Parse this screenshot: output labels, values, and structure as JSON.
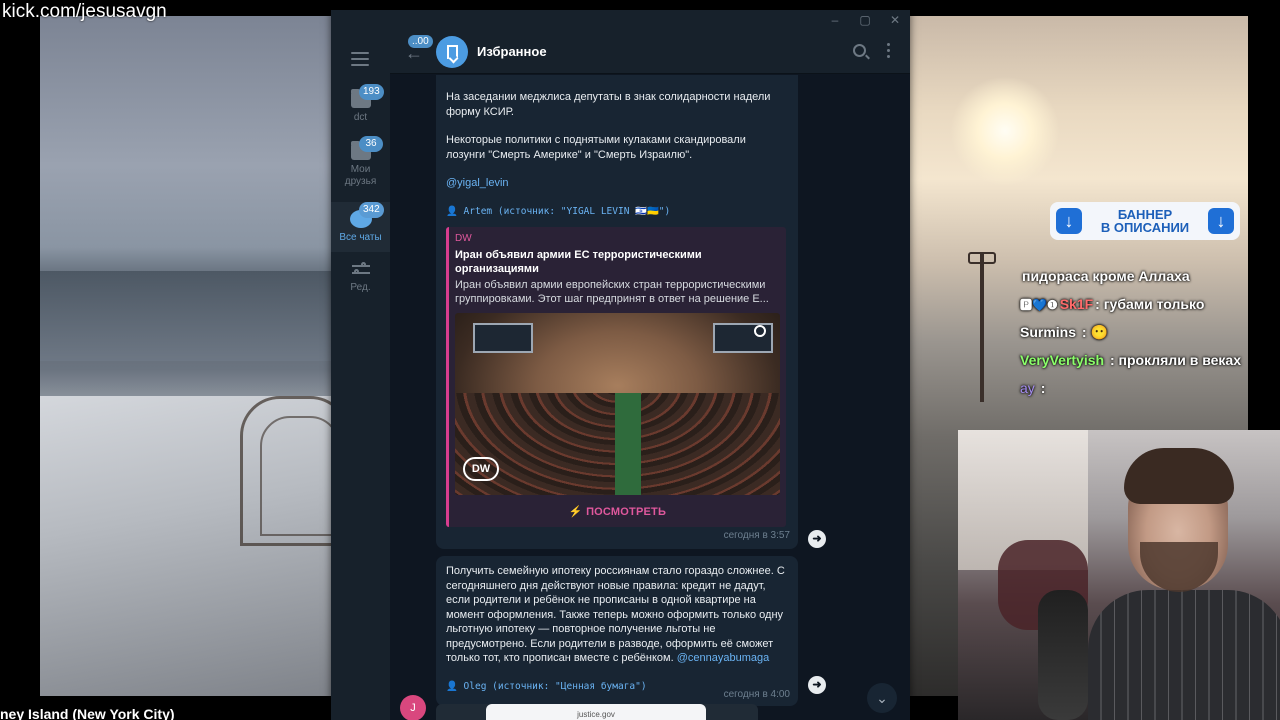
{
  "stream": {
    "url_overlay": "kick.com/jesusavgn",
    "location_caption": "ney Island (New York City)"
  },
  "banner": {
    "line1": "БАННЕР",
    "line2": "В ОПИСАНИИ"
  },
  "chat": [
    {
      "nick": "",
      "nick_color": "#ffffff",
      "text": "пидораса кроме Аллаха"
    },
    {
      "nick": "Sk1F",
      "nick_color": "#ff6b6b",
      "badges": "🅿💙❶",
      "text": ": губами только"
    },
    {
      "nick": "Surmins",
      "nick_color": "#ffffff",
      "text": ": 😶"
    },
    {
      "nick": "VeryVertyish",
      "nick_color": "#8bff6a",
      "text": ": прокляли в веках"
    },
    {
      "nick": "ay",
      "nick_color": "#a48cf0",
      "text": ":"
    }
  ],
  "telegram": {
    "window_controls": [
      "–",
      "▢",
      "✕"
    ],
    "unread_back": "..00",
    "chat_title": "Избранное",
    "folders": [
      {
        "label": "dct",
        "badge": "193"
      },
      {
        "label": "Мои друзья",
        "badge": "36"
      },
      {
        "label": "Все чаты",
        "badge": "342"
      },
      {
        "label": "Ред.",
        "badge": ""
      }
    ],
    "message1": {
      "para1": "На заседании меджлиса депутаты в знак солидарности надели форму КСИР.",
      "para2": "Некоторые политики с поднятыми кулаками скандировали лозунги \"Смерть Америке\" и \"Смерть Израилю\".",
      "link": "@yigal_levin",
      "forward": "👤 Artem (источник: \"YIGAL LEVIN 🇮🇱🇺🇦\")",
      "preview": {
        "site": "DW",
        "title": "Иран объявил армии ЕС террористическими организациями",
        "description": "Иран объявил армии европейских стран террористическими группировками. Этот шаг предпринят в ответ на решение Е...",
        "logo": "DW",
        "button": "⚡ ПОСМОТРЕТЬ"
      },
      "time": "сегодня в 3:57"
    },
    "message2": {
      "text": "Получить семейную ипотеку россиянам стало гораздо сложнее. С сегодняшнего дня действуют новые правила: кредит не дадут, если родители и ребёнок не прописаны в одной квартире на момент оформления. Также теперь можно оформить только одну льготную ипотеку — повторное получение льготы не предусмотрено. Если родители в разводе, оформить её сможет только тот, кто прописан вместе с ребёнком.",
      "link": "@cennayabumaga",
      "forward": "👤 Oleg (источник: \"Ценная бумага\")",
      "time": "сегодня в 4:00"
    },
    "mini_avatar_letter": "J",
    "next_preview_text": "justice.gov"
  }
}
